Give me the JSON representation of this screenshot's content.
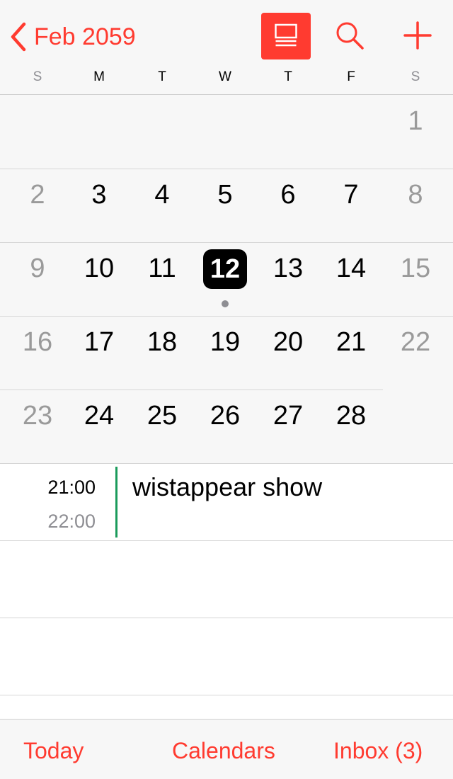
{
  "header": {
    "month_title": "Feb 2059",
    "icons": {
      "back": "chevron-left-icon",
      "list_toggle": "list-view-icon",
      "search": "search-icon",
      "add": "plus-icon"
    },
    "accent_color": "#ff3b30"
  },
  "weekdays": [
    "S",
    "M",
    "T",
    "W",
    "T",
    "F",
    "S"
  ],
  "month": {
    "weeks": [
      [
        "",
        "",
        "",
        "",
        "",
        "",
        "1"
      ],
      [
        "2",
        "3",
        "4",
        "5",
        "6",
        "7",
        "8"
      ],
      [
        "9",
        "10",
        "11",
        "12",
        "13",
        "14",
        "15"
      ],
      [
        "16",
        "17",
        "18",
        "19",
        "20",
        "21",
        "22"
      ],
      [
        "23",
        "24",
        "25",
        "26",
        "27",
        "28",
        ""
      ]
    ],
    "selected_day": "12"
  },
  "events": [
    {
      "start": "21:00",
      "end": "22:00",
      "title": "wistappear show",
      "calendar_color": "#1b9b5b"
    }
  ],
  "tabbar": {
    "today": "Today",
    "calendars": "Calendars",
    "inbox": "Inbox (3)"
  }
}
